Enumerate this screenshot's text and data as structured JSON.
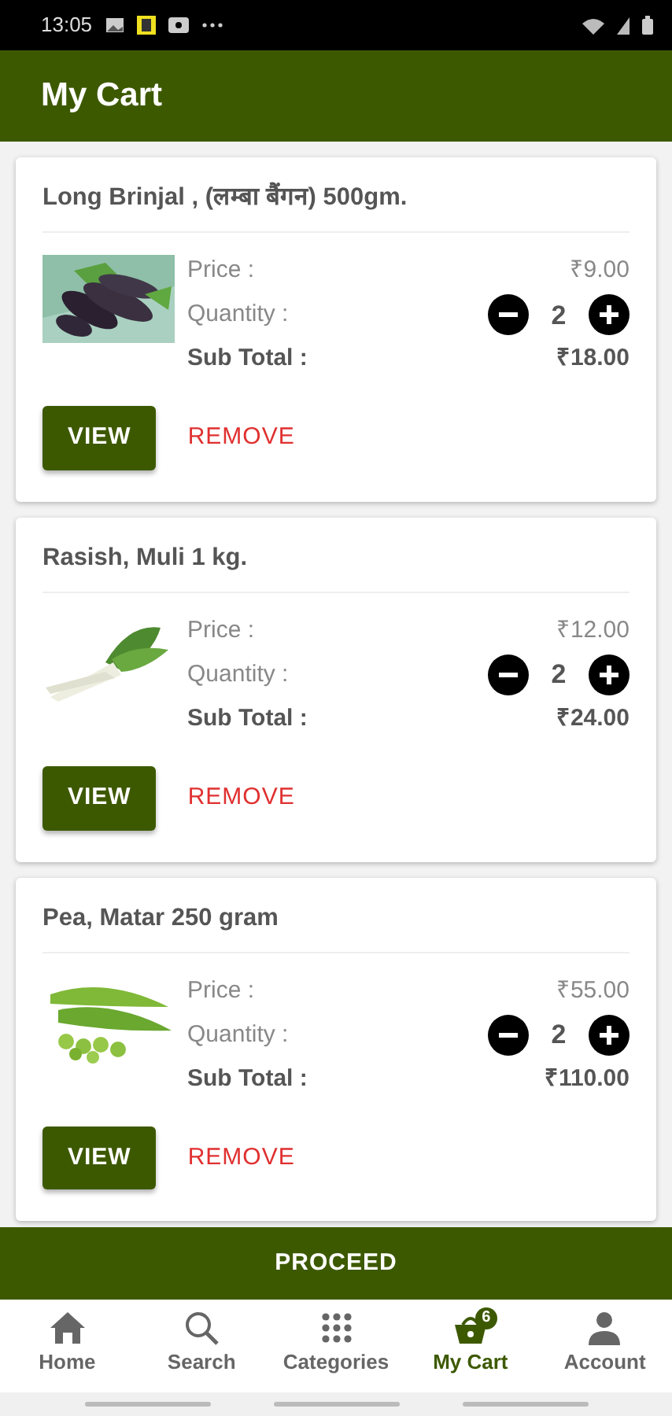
{
  "status_bar": {
    "time": "13:05"
  },
  "header": {
    "title": "My Cart"
  },
  "items": [
    {
      "name": "Long Brinjal , (लम्बा बैंगन) 500gm.",
      "price_label": "Price :",
      "price": "₹9.00",
      "quantity_label": "Quantity :",
      "quantity": "2",
      "subtotal_label": "Sub Total :",
      "subtotal": "₹18.00",
      "view": "VIEW",
      "remove": "REMOVE"
    },
    {
      "name": "Rasish, Muli 1 kg.",
      "price_label": "Price :",
      "price": "₹12.00",
      "quantity_label": "Quantity :",
      "quantity": "2",
      "subtotal_label": "Sub Total :",
      "subtotal": "₹24.00",
      "view": "VIEW",
      "remove": "REMOVE"
    },
    {
      "name": "Pea, Matar 250 gram",
      "price_label": "Price :",
      "price": "₹55.00",
      "quantity_label": "Quantity :",
      "quantity": "2",
      "subtotal_label": "Sub Total :",
      "subtotal": "₹110.00",
      "view": "VIEW",
      "remove": "REMOVE"
    }
  ],
  "proceed": "PROCEED",
  "bottom_nav": [
    {
      "label": "Home",
      "selected": false
    },
    {
      "label": "Search",
      "selected": false
    },
    {
      "label": "Categories",
      "selected": false
    },
    {
      "label": "My Cart",
      "selected": true,
      "badge": "6"
    },
    {
      "label": "Account",
      "selected": false
    }
  ]
}
